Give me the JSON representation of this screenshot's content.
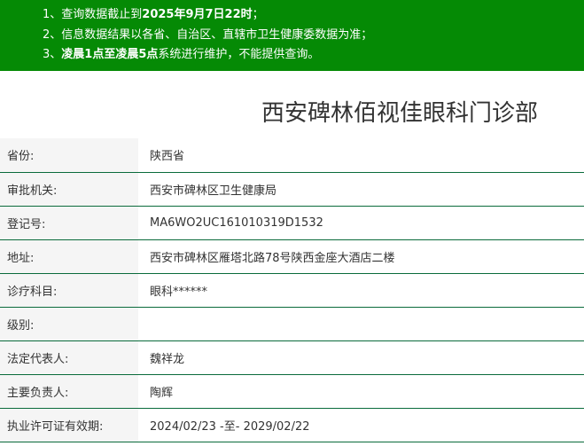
{
  "notice": {
    "line1_prefix": "1、查询数据截止到",
    "line1_bold": "2025年9月7日22时",
    "line1_suffix": "；",
    "line2": "2、信息数据结果以各省、自治区、直辖市卫生健康委数据为准；",
    "line3_prefix": "3、",
    "line3_bold": "凌晨1点至凌晨5点",
    "line3_suffix": "系统进行维护，不能提供查询。"
  },
  "page_title": "西安碑林佰视佳眼科门诊部",
  "rows": [
    {
      "label": "省份:",
      "value": "陕西省"
    },
    {
      "label": "审批机关:",
      "value": "西安市碑林区卫生健康局"
    },
    {
      "label": "登记号:",
      "value": "MA6WO2UC161010319D1532"
    },
    {
      "label": "地址:",
      "value": "西安市碑林区雁塔北路78号陕西金座大酒店二楼"
    },
    {
      "label": "诊疗科目:",
      "value": "眼科******"
    },
    {
      "label": "级别:",
      "value": ""
    },
    {
      "label": "法定代表人:",
      "value": "魏祥龙"
    },
    {
      "label": "主要负责人:",
      "value": "陶辉"
    },
    {
      "label": "执业许可证有效期:",
      "value": "2024/02/23 -至- 2029/02/22"
    }
  ]
}
